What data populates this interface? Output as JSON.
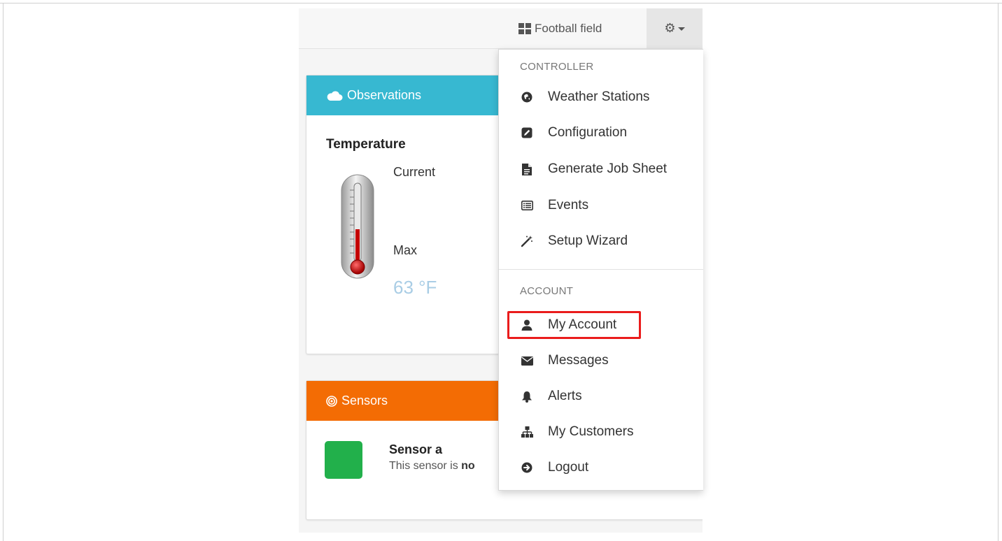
{
  "navbar": {
    "field_label": "Football field",
    "gear_icon": "gears-icon"
  },
  "observations": {
    "title": "Observations",
    "icon": "cloud-icon",
    "temperature_title": "Temperature",
    "current_label": "Current",
    "max_label": "Max",
    "max_value": "63 °F"
  },
  "sensors": {
    "title": "Sensors",
    "icon": "target-icon",
    "sensor_name": "Sensor a",
    "sensor_desc_prefix": "This sensor is ",
    "sensor_desc_bold": "no",
    "status_color": "#22b04b"
  },
  "menu": {
    "controller_header": "CONTROLLER",
    "account_header": "ACCOUNT",
    "items": [
      {
        "label": "Weather Stations",
        "icon": "globe-icon"
      },
      {
        "label": "Configuration",
        "icon": "edit-icon"
      },
      {
        "label": "Generate Job Sheet",
        "icon": "file-icon"
      },
      {
        "label": "Events",
        "icon": "list-icon"
      },
      {
        "label": "Setup Wizard",
        "icon": "magic-wand-icon"
      },
      {
        "label": "My Account",
        "icon": "user-icon"
      },
      {
        "label": "Messages",
        "icon": "envelope-icon"
      },
      {
        "label": "Alerts",
        "icon": "bell-icon"
      },
      {
        "label": "My Customers",
        "icon": "sitemap-icon"
      },
      {
        "label": "Logout",
        "icon": "circle-arrow-right-icon"
      }
    ]
  },
  "colors": {
    "observations_header": "#37b8d1",
    "sensors_header": "#f36c04",
    "highlight_border": "#ea1c1c"
  }
}
